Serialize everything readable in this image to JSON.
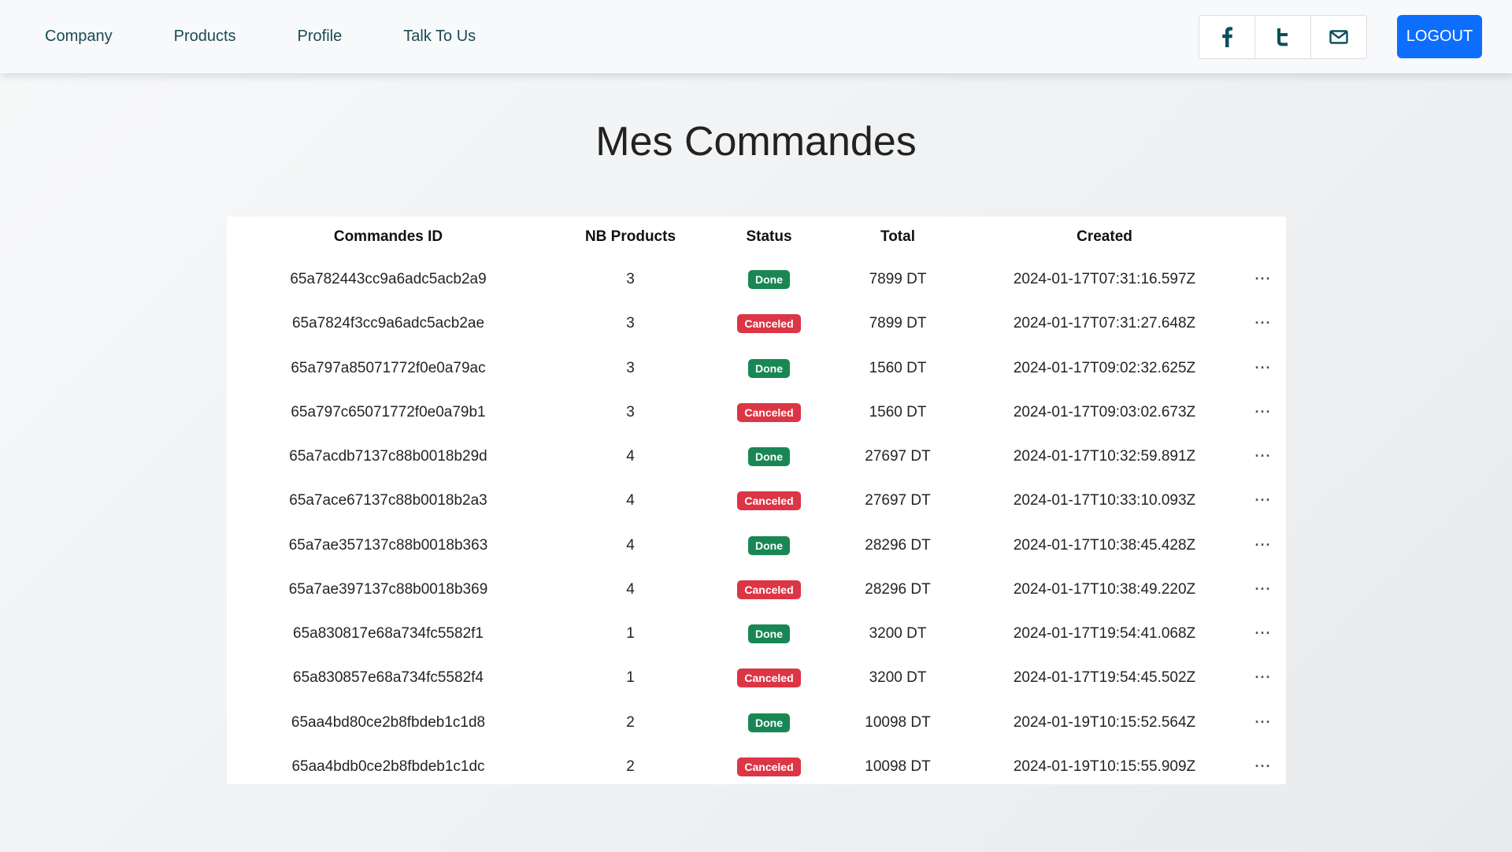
{
  "nav": {
    "links": [
      "Company",
      "Products",
      "Profile",
      "Talk To Us"
    ],
    "social": [
      "facebook-icon",
      "twitter-icon",
      "mail-icon"
    ],
    "logout_label": "LOGOUT",
    "accent_color": "#0d6efd"
  },
  "page": {
    "title": "Mes Commandes"
  },
  "table": {
    "headers": {
      "id": "Commandes ID",
      "nb": "NB Products",
      "status": "Status",
      "total": "Total",
      "created": "Created"
    },
    "status_colors": {
      "Done": "#198754",
      "Canceled": "#dc3545"
    },
    "actions_icon": "more-dots-icon",
    "rows": [
      {
        "id": "65a782443cc9a6adc5acb2a9",
        "nb": "3",
        "status": "Done",
        "total": "7899 DT",
        "created": "2024-01-17T07:31:16.597Z",
        "action": "···"
      },
      {
        "id": "65a7824f3cc9a6adc5acb2ae",
        "nb": "3",
        "status": "Canceled",
        "total": "7899 DT",
        "created": "2024-01-17T07:31:27.648Z",
        "action": "···"
      },
      {
        "id": "65a797a85071772f0e0a79ac",
        "nb": "3",
        "status": "Done",
        "total": "1560 DT",
        "created": "2024-01-17T09:02:32.625Z",
        "action": "···"
      },
      {
        "id": "65a797c65071772f0e0a79b1",
        "nb": "3",
        "status": "Canceled",
        "total": "1560 DT",
        "created": "2024-01-17T09:03:02.673Z",
        "action": "···"
      },
      {
        "id": "65a7acdb7137c88b0018b29d",
        "nb": "4",
        "status": "Done",
        "total": "27697 DT",
        "created": "2024-01-17T10:32:59.891Z",
        "action": "···"
      },
      {
        "id": "65a7ace67137c88b0018b2a3",
        "nb": "4",
        "status": "Canceled",
        "total": "27697 DT",
        "created": "2024-01-17T10:33:10.093Z",
        "action": "···"
      },
      {
        "id": "65a7ae357137c88b0018b363",
        "nb": "4",
        "status": "Done",
        "total": "28296 DT",
        "created": "2024-01-17T10:38:45.428Z",
        "action": "···"
      },
      {
        "id": "65a7ae397137c88b0018b369",
        "nb": "4",
        "status": "Canceled",
        "total": "28296 DT",
        "created": "2024-01-17T10:38:49.220Z",
        "action": "···"
      },
      {
        "id": "65a830817e68a734fc5582f1",
        "nb": "1",
        "status": "Done",
        "total": "3200 DT",
        "created": "2024-01-17T19:54:41.068Z",
        "action": "···"
      },
      {
        "id": "65a830857e68a734fc5582f4",
        "nb": "1",
        "status": "Canceled",
        "total": "3200 DT",
        "created": "2024-01-17T19:54:45.502Z",
        "action": "···"
      },
      {
        "id": "65aa4bd80ce2b8fbdeb1c1d8",
        "nb": "2",
        "status": "Done",
        "total": "10098 DT",
        "created": "2024-01-19T10:15:52.564Z",
        "action": "···"
      },
      {
        "id": "65aa4bdb0ce2b8fbdeb1c1dc",
        "nb": "2",
        "status": "Canceled",
        "total": "10098 DT",
        "created": "2024-01-19T10:15:55.909Z",
        "action": "···"
      }
    ]
  }
}
